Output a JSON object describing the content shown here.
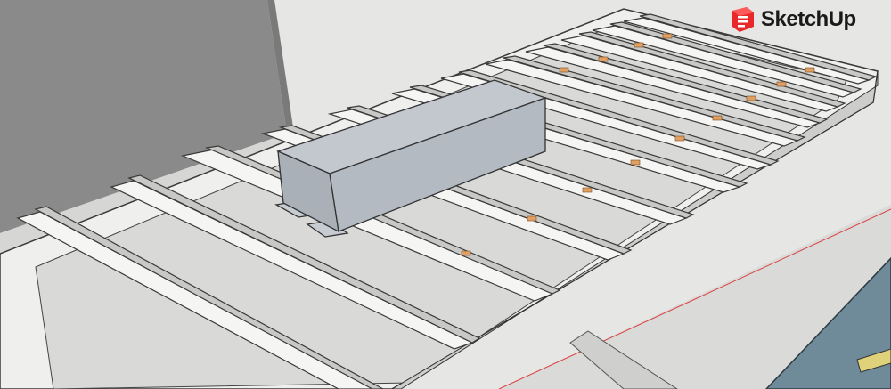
{
  "app": {
    "brand_name": "SketchUp",
    "logo_icon": "sketchup-logo-icon",
    "brand_color": "#e8282b"
  },
  "scene": {
    "model": "metal-joist-floor-with-duct",
    "axis_color": "#d94040",
    "panel_color": "#6f8a99"
  }
}
